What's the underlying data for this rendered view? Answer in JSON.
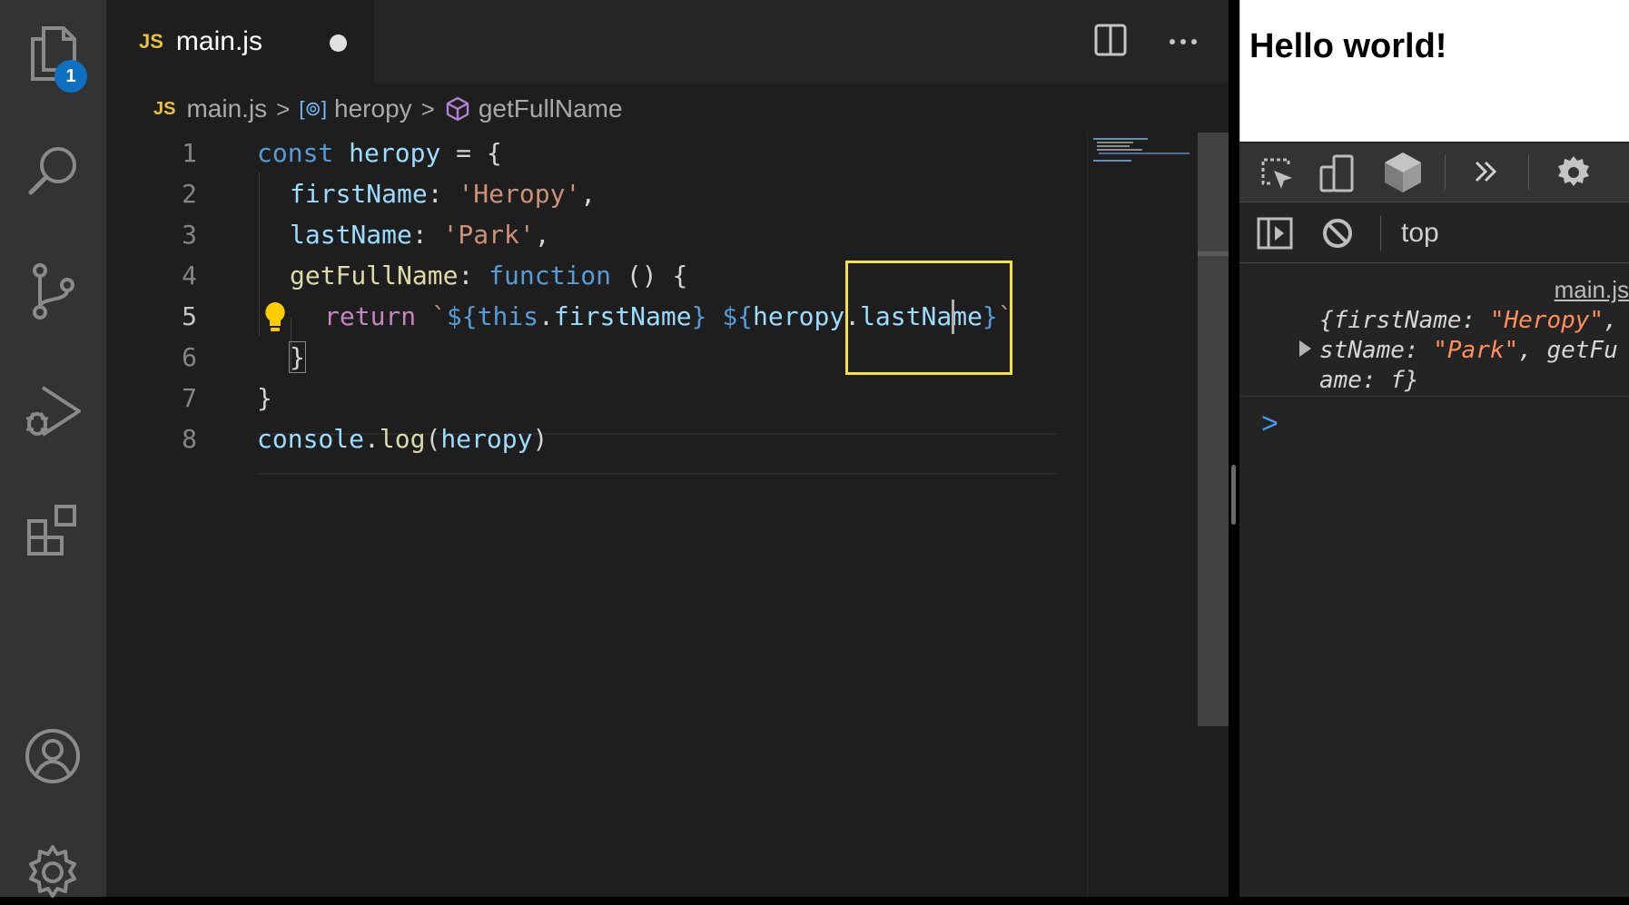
{
  "activity_bar": {
    "items": [
      {
        "icon": "files-icon",
        "badge": "1"
      },
      {
        "icon": "search-icon"
      },
      {
        "icon": "source-control-icon"
      },
      {
        "icon": "run-debug-icon"
      },
      {
        "icon": "extensions-icon"
      },
      {
        "icon": "account-icon"
      },
      {
        "icon": "gear-icon"
      }
    ]
  },
  "editor": {
    "tab": {
      "lang_badge": "JS",
      "filename": "main.js",
      "modified": true
    },
    "breadcrumb": {
      "lang_badge": "JS",
      "file": "main.js",
      "symbol1_icon": "[⊚]",
      "symbol1": "heropy",
      "symbol2": "getFullName"
    },
    "line_numbers": [
      "1",
      "2",
      "3",
      "4",
      "5",
      "6",
      "7",
      "8"
    ],
    "active_line": "5",
    "code": {
      "l1": {
        "kw": "const",
        "name": "heropy",
        "rest": " = {"
      },
      "l2": {
        "key": "firstName",
        "colon": ": ",
        "val": "'Heropy'",
        "tail": ","
      },
      "l3": {
        "key": "lastName",
        "colon": ": ",
        "val": "'Park'",
        "tail": ","
      },
      "l4": {
        "key": "getFullName",
        "colon": ": ",
        "kw": "function",
        "rest": " () {"
      },
      "l5": {
        "kw": "return",
        "p1": " `",
        "t1": "${",
        "this": "this",
        "dot1": ".",
        "prop1": "firstName",
        "t2": "}",
        "sp": " ",
        "t3": "${",
        "obj": "heropy",
        "dot2": ".",
        "prop2": "lastName",
        "t4": "}",
        "end": "`"
      },
      "l6": {
        "text": "}"
      },
      "l7": {
        "text": "}"
      },
      "l8": {
        "fn1": "console",
        "dot": ".",
        "fn2": "log",
        "p1": "(",
        "arg": "heropy",
        "p2": ")"
      }
    }
  },
  "browser": {
    "page_heading": "Hello world!",
    "context": "top",
    "log_source": "main.js",
    "log_lines": {
      "l1a": "{firstName: ",
      "l1b": "\"Heropy\"",
      "l1c": ", la",
      "l2a": "stName: ",
      "l2b": "\"Park\"",
      "l2c": ", getFu",
      "l3": "ame: f}"
    },
    "prompt": ">"
  }
}
